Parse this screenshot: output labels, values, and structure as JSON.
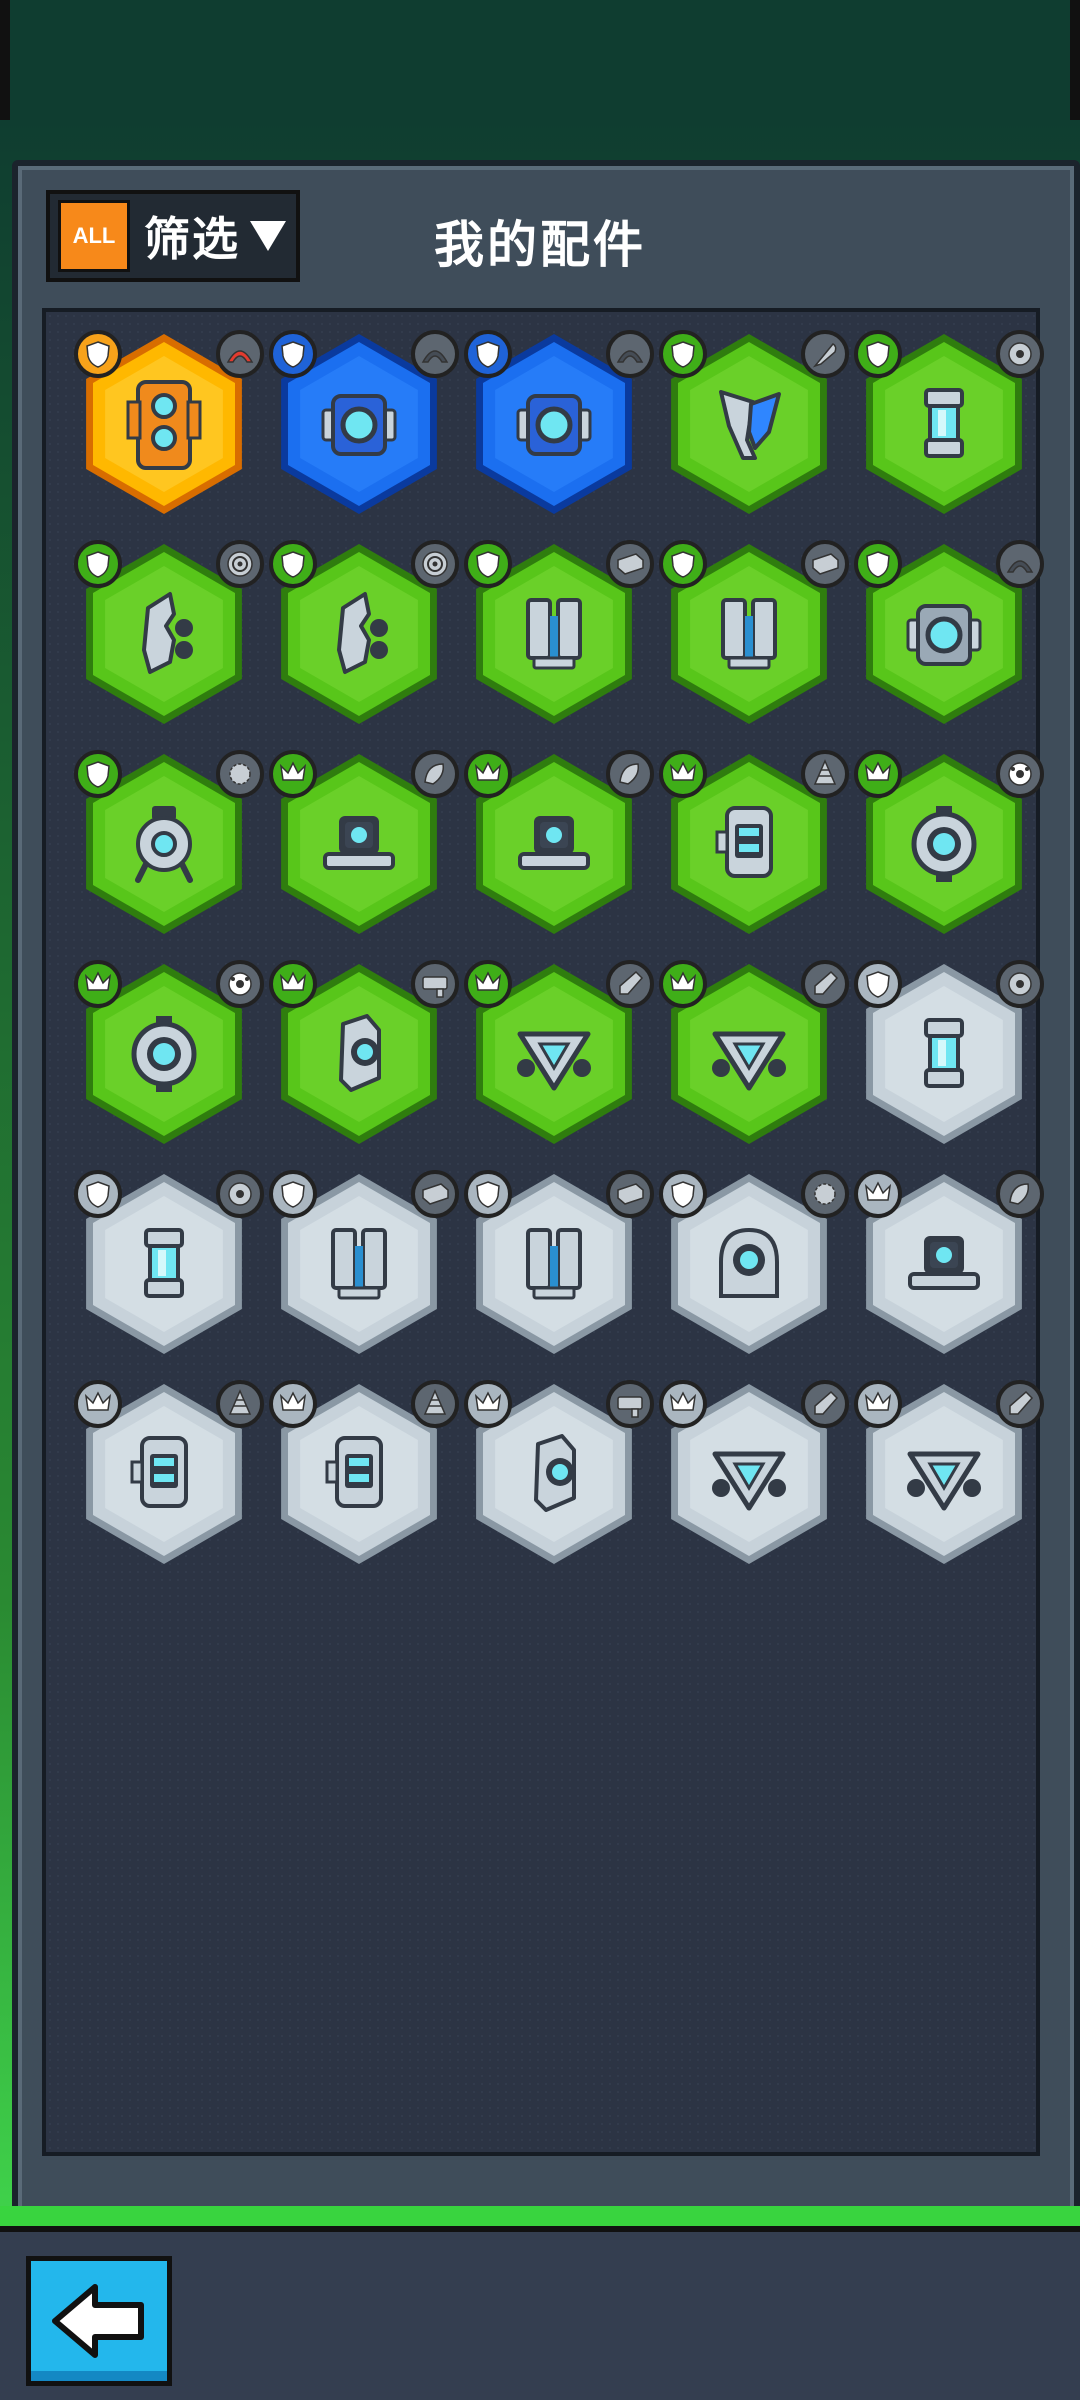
{
  "header": {
    "filter_badge": "ALL",
    "filter_label": "筛选",
    "title": "我的配件"
  },
  "colors": {
    "legendary": "#ffb800",
    "epic": "#1b6ff0",
    "rare": "#58c61a",
    "common": "#c7d2da",
    "accent_orange": "#f7891a",
    "back_button": "#23b7ec"
  },
  "items": [
    {
      "rarity": "legendary",
      "part": "twin-eye-block",
      "left": "shield",
      "right": "helmet-red"
    },
    {
      "rarity": "epic",
      "part": "core-cube",
      "left": "shield",
      "right": "helmet-gray"
    },
    {
      "rarity": "epic",
      "part": "core-cube",
      "left": "shield",
      "right": "helmet-gray"
    },
    {
      "rarity": "rare",
      "part": "angled-plate",
      "left": "shield",
      "right": "feather"
    },
    {
      "rarity": "rare",
      "part": "capsule-tube",
      "left": "shield",
      "right": "gear-star"
    },
    {
      "rarity": "rare",
      "part": "side-claw",
      "left": "shield",
      "right": "turbine"
    },
    {
      "rarity": "rare",
      "part": "side-claw",
      "left": "shield",
      "right": "turbine"
    },
    {
      "rarity": "rare",
      "part": "twin-pillar",
      "left": "shield",
      "right": "brick"
    },
    {
      "rarity": "rare",
      "part": "twin-pillar",
      "left": "shield",
      "right": "brick"
    },
    {
      "rarity": "rare",
      "part": "core-cube",
      "left": "shield",
      "right": "helmet-gray"
    },
    {
      "rarity": "rare",
      "part": "eye-walker",
      "left": "shield",
      "right": "spiky"
    },
    {
      "rarity": "rare",
      "part": "dome-base",
      "left": "crown",
      "right": "shell"
    },
    {
      "rarity": "rare",
      "part": "dome-base",
      "left": "crown",
      "right": "shell"
    },
    {
      "rarity": "rare",
      "part": "cabinet",
      "left": "crown",
      "right": "drill"
    },
    {
      "rarity": "rare",
      "part": "eye-ring",
      "left": "crown",
      "right": "ball"
    },
    {
      "rarity": "rare",
      "part": "eye-ring",
      "left": "crown",
      "right": "ball"
    },
    {
      "rarity": "rare",
      "part": "eye-pod",
      "left": "crown",
      "right": "gun"
    },
    {
      "rarity": "rare",
      "part": "tri-emitter",
      "left": "crown",
      "right": "bottle"
    },
    {
      "rarity": "rare",
      "part": "tri-emitter",
      "left": "crown",
      "right": "bottle"
    },
    {
      "rarity": "common",
      "part": "capsule-tube",
      "left": "shield",
      "right": "gear-star"
    },
    {
      "rarity": "common",
      "part": "capsule-tube",
      "left": "shield",
      "right": "gear-star"
    },
    {
      "rarity": "common",
      "part": "twin-pillar",
      "left": "shield",
      "right": "brick"
    },
    {
      "rarity": "common",
      "part": "twin-pillar",
      "left": "shield",
      "right": "brick"
    },
    {
      "rarity": "common",
      "part": "eye-dome",
      "left": "shield",
      "right": "spiky"
    },
    {
      "rarity": "common",
      "part": "dome-base",
      "left": "crown",
      "right": "shell"
    },
    {
      "rarity": "common",
      "part": "cabinet",
      "left": "crown",
      "right": "drill"
    },
    {
      "rarity": "common",
      "part": "cabinet",
      "left": "crown",
      "right": "drill"
    },
    {
      "rarity": "common",
      "part": "eye-pod",
      "left": "crown",
      "right": "gun"
    },
    {
      "rarity": "common",
      "part": "tri-emitter",
      "left": "crown",
      "right": "bottle"
    },
    {
      "rarity": "common",
      "part": "tri-emitter",
      "left": "crown",
      "right": "bottle"
    }
  ]
}
